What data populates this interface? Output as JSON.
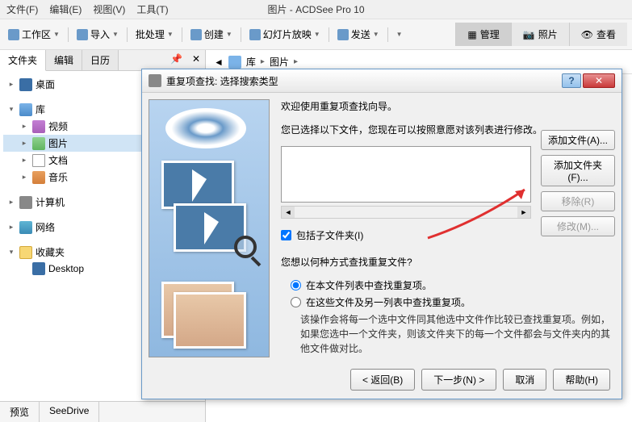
{
  "app_title": "图片 - ACDSee Pro 10",
  "menubar": {
    "file": "文件(F)",
    "edit": "编辑(E)",
    "view": "视图(V)",
    "tools": "工具(T)"
  },
  "toolbar": {
    "workspace": "工作区",
    "import": "导入",
    "batch": "批处理",
    "create": "创建",
    "slideshow": "幻灯片放映",
    "send": "发送"
  },
  "mode_tabs": {
    "manage": "管理",
    "photo": "照片",
    "view": "查看"
  },
  "left_panel": {
    "tabs": {
      "folders": "文件夹",
      "edit": "编辑",
      "calendar": "日历"
    },
    "items": {
      "desktop": "桌面",
      "library": "库",
      "video": "视频",
      "pictures": "图片",
      "documents": "文档",
      "music": "音乐",
      "computer": "计算机",
      "network": "网络",
      "favorites": "收藏夹",
      "desktop2": "Desktop"
    },
    "bottom_tabs": {
      "preview": "预览",
      "seedrive": "SeeDrive"
    }
  },
  "breadcrumb": {
    "lib": "库",
    "pictures": "图片"
  },
  "dialog": {
    "title": "重复项查找: 选择搜索类型",
    "welcome": "欢迎使用重复项查找向导。",
    "instruction": "您已选择以下文件，您现在可以按照意愿对该列表进行修改。",
    "buttons": {
      "add_file": "添加文件(A)...",
      "add_folder": "添加文件夹(F)...",
      "remove": "移除(R)",
      "modify": "修改(M)..."
    },
    "include_sub": "包括子文件夹(I)",
    "question": "您想以何种方式查找重复文件?",
    "radio1": "在本文件列表中查找重复项。",
    "radio2": "在这些文件及另一列表中查找重复项。",
    "note": "该操作会将每一个选中文件同其他选中文件作比较已查找重复项。例如，如果您选中一个文件夹，则该文件夹下的每一个文件都会与文件夹内的其他文件做对比。",
    "footer": {
      "back": "< 返回(B)",
      "next": "下一步(N) >",
      "cancel": "取消",
      "help": "帮助(H)"
    }
  }
}
